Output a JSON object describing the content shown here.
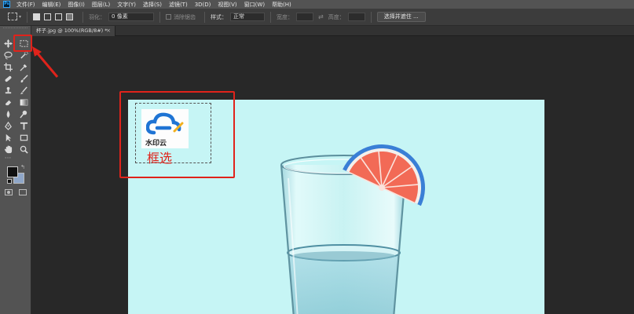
{
  "menubar": {
    "app_logo": "Ps",
    "items": [
      "文件(F)",
      "编辑(E)",
      "图像(I)",
      "图层(L)",
      "文字(Y)",
      "选择(S)",
      "滤镜(T)",
      "3D(D)",
      "视图(V)",
      "窗口(W)",
      "帮助(H)"
    ]
  },
  "options_bar": {
    "feather_label": "羽化：",
    "feather_value": "0 像素",
    "antialias_label": "消除锯齿",
    "style_label": "样式：",
    "style_value": "正常",
    "width_label": "宽度：",
    "height_label": "高度：",
    "select_mask_button": "选择并遮住 ..."
  },
  "document": {
    "tab_title": "杯子.jpg @ 100%(RGB/8#) *",
    "tab_close": "×",
    "watermark_logo_text": "水印云"
  },
  "annotation": {
    "caption": "框选",
    "color": "#e0231b"
  },
  "tools": {
    "foreground_color": "#111111",
    "background_color": "#8fa6c8"
  }
}
